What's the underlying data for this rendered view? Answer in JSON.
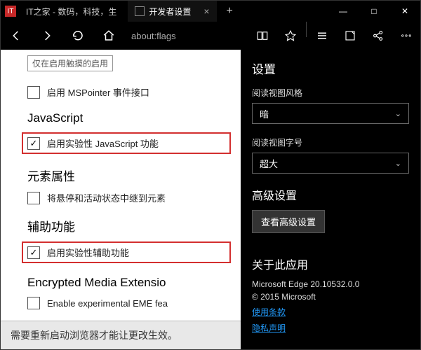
{
  "titlebar": {
    "favicon_text": "IT",
    "site_title": "IT之家 - 数码，科技，生",
    "tab_label": "开发者设置",
    "close_tab": "×",
    "new_tab": "+",
    "minimize": "—",
    "maximize": "□",
    "close": "✕"
  },
  "toolbar": {
    "url": "about:flags"
  },
  "page": {
    "truncated_top": "仅在启用触摸的启用",
    "mspointer_label": "启用 MSPointer 事件接口",
    "js_heading": "JavaScript",
    "js_experimental_label": "启用实验性 JavaScript 功能",
    "elementattrs_heading": "元素属性",
    "elementattrs_label": "将悬停和活动状态中继到元素",
    "accessibility_heading": "辅助功能",
    "accessibility_label": "启用实验性辅助功能",
    "eme_heading": "Encrypted Media Extensio",
    "eme_label": "Enable experimental EME fea",
    "restart_notice": "需要重新启动浏览器才能让更改生效。"
  },
  "panel": {
    "title": "设置",
    "reading_style_label": "阅读视图风格",
    "reading_style_value": "暗",
    "reading_font_label": "阅读视图字号",
    "reading_font_value": "超大",
    "advanced_heading": "高级设置",
    "advanced_button": "查看高级设置",
    "about_heading": "关于此应用",
    "version": "Microsoft Edge 20.10532.0.0",
    "copyright": "© 2015 Microsoft",
    "terms_link": "使用条款",
    "privacy_link": "隐私声明"
  }
}
